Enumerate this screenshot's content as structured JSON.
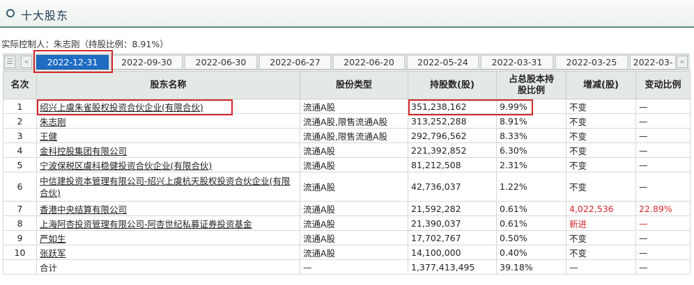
{
  "header": {
    "title": "十大股东"
  },
  "controller": "实际控制人：朱志刚（持股比例：8.91%）",
  "nav": {
    "list_glyph": "☰",
    "prev_glyph": "«",
    "next_glyph": "»"
  },
  "tabs": [
    "2022-12-31",
    "2022-09-30",
    "2022-06-30",
    "2022-06-27",
    "2022-06-20",
    "2022-05-24",
    "2022-03-31",
    "2022-03-25",
    "2022-03-"
  ],
  "active_tab": "2022-12-31",
  "columns": {
    "rank": "名次",
    "name": "股东名称",
    "type": "股份类型",
    "shares": "持股数(股)",
    "ratio_l1": "占总股本持",
    "ratio_l2": "股比例",
    "change": "增减(股)",
    "change_ratio": "变动比例"
  },
  "rows": [
    {
      "rank": "1",
      "name": "绍兴上虞朱雀股权投资合伙企业(有限合伙)",
      "type": "流通A股",
      "shares": "351,238,162",
      "ratio": "9.99%",
      "change": "不变",
      "change_ratio": "—"
    },
    {
      "rank": "2",
      "name": "朱志刚",
      "type": "流通A股,限售流通A股",
      "shares": "313,252,288",
      "ratio": "8.91%",
      "change": "不变",
      "change_ratio": "—"
    },
    {
      "rank": "3",
      "name": "王健",
      "type": "流通A股,限售流通A股",
      "shares": "292,796,562",
      "ratio": "8.33%",
      "change": "不变",
      "change_ratio": "—"
    },
    {
      "rank": "4",
      "name": "金科控股集团有限公司",
      "type": "流通A股",
      "shares": "221,392,852",
      "ratio": "6.30%",
      "change": "不变",
      "change_ratio": "—"
    },
    {
      "rank": "5",
      "name": "宁波保税区虞科稳健投资合伙企业(有限合伙)",
      "type": "流通A股",
      "shares": "81,212,508",
      "ratio": "2.31%",
      "change": "不变",
      "change_ratio": "—"
    },
    {
      "rank": "6",
      "name": "中信建投资本管理有限公司-绍兴上虞杭天股权投资合伙企业(有限合伙)",
      "type": "流通A股",
      "shares": "42,736,037",
      "ratio": "1.22%",
      "change": "不变",
      "change_ratio": "—"
    },
    {
      "rank": "7",
      "name": "香港中央结算有限公司",
      "type": "流通A股",
      "shares": "21,592,282",
      "ratio": "0.61%",
      "change": "4,022,536",
      "change_ratio": "22.89%"
    },
    {
      "rank": "8",
      "name": "上海阿杏投资管理有限公司-阿杏世纪私募证券投资基金",
      "type": "流通A股",
      "shares": "21,390,037",
      "ratio": "0.61%",
      "change": "新进",
      "change_ratio": "—"
    },
    {
      "rank": "9",
      "name": "严如生",
      "type": "流通A股",
      "shares": "17,702,767",
      "ratio": "0.50%",
      "change": "不变",
      "change_ratio": "—"
    },
    {
      "rank": "10",
      "name": "张跃军",
      "type": "流通A股",
      "shares": "14,100,000",
      "ratio": "0.40%",
      "change": "不变",
      "change_ratio": "—"
    }
  ],
  "total": {
    "label": "合计",
    "type": "—",
    "shares": "1,377,413,495",
    "ratio": "39.18%",
    "change": "—",
    "change_ratio": "—"
  },
  "colors": {
    "accent": "#1f6cc4",
    "highlight": "#d3262b",
    "header_bg": "#e4e9e6"
  }
}
